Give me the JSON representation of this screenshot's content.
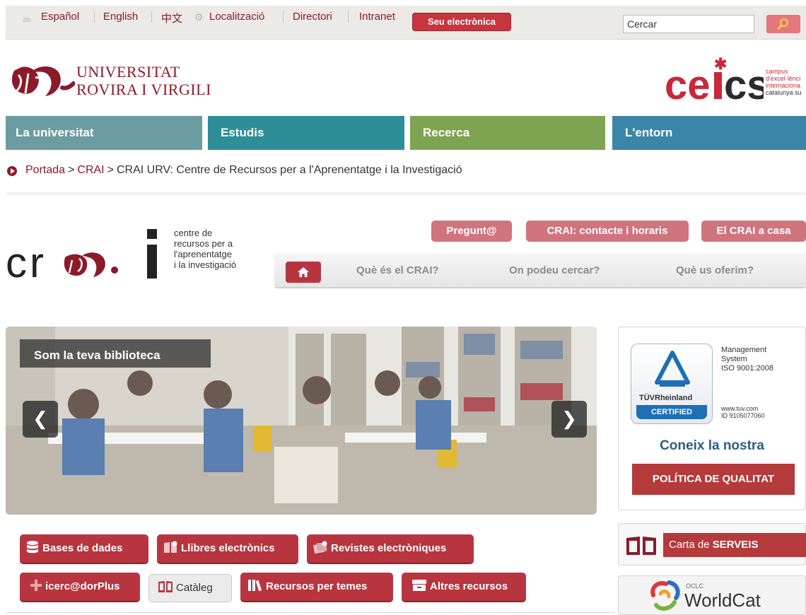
{
  "topbar": {
    "languages": [
      "Español",
      "English",
      "中文"
    ],
    "links": [
      "Localització",
      "Directori",
      "Intranet"
    ],
    "seu_label": "Seu electrònica",
    "search_value": "Cercar"
  },
  "brand": {
    "university_line1": "UNIVERSITAT",
    "university_line2": "ROVIRA I VIRGILI",
    "ceics_logo": "cei*cs",
    "ceics_lines": [
      "campus",
      "d'excel·lènci",
      "internaciona",
      "catalunya su"
    ]
  },
  "main_nav": [
    "La universitat",
    "Estudis",
    "Recerca",
    "L'entorn"
  ],
  "breadcrumb": {
    "home": "Portada",
    "separator": ">",
    "section": "CRAI",
    "current": "CRAI URV: Centre de Recursos per a l'Aprenentatge i la Investigació"
  },
  "crai": {
    "logo_text": "cr i",
    "tagline": [
      "centre de",
      "recursos per a",
      "l'aprenentatge",
      "i la investigació"
    ],
    "quick_buttons": [
      "Pregunt@",
      "CRAI: contacte i horaris",
      "El CRAI a casa"
    ],
    "subnav": [
      "Què és el CRAI?",
      "On podeu cercar?",
      "Què us oferim?"
    ]
  },
  "slider": {
    "caption": "Som la teva biblioteca",
    "prev": "❮",
    "next": "❯"
  },
  "quality": {
    "tuv_brand": "TÜVRheinland",
    "tuv_certified": "CERTIFIED",
    "system_lines": [
      "Management",
      "System",
      "ISO 9001:2008"
    ],
    "web_lines": [
      "www.tuv.com",
      "ID 9105077060"
    ],
    "coneix": "Coneix la nostra",
    "politica_label": "POLÍTICA DE QUALITAT"
  },
  "carta": {
    "prefix": "Carta de ",
    "strong": "SERVEIS"
  },
  "worldcat": {
    "oclc": "OCLC",
    "name": "WorldCat"
  },
  "resources": {
    "bases_label": "Bases de dades",
    "llibres_label": "Llibres electrònics",
    "revistes_label": "Revistes electròniques",
    "icercador_label": "icerc@dorPlus",
    "cataleg_label": "Catàleg",
    "temes_label": "Recursos per temes",
    "altres_label": "Altres recursos"
  },
  "colors": {
    "brand_red": "#8b1a2b",
    "button_red": "#b8353f",
    "pink": "#d0747d",
    "nav_universitat": "#6b9ca0",
    "nav_estudis": "#2d8e98",
    "nav_recerca": "#7ea351",
    "nav_entorn": "#3b86a8"
  }
}
